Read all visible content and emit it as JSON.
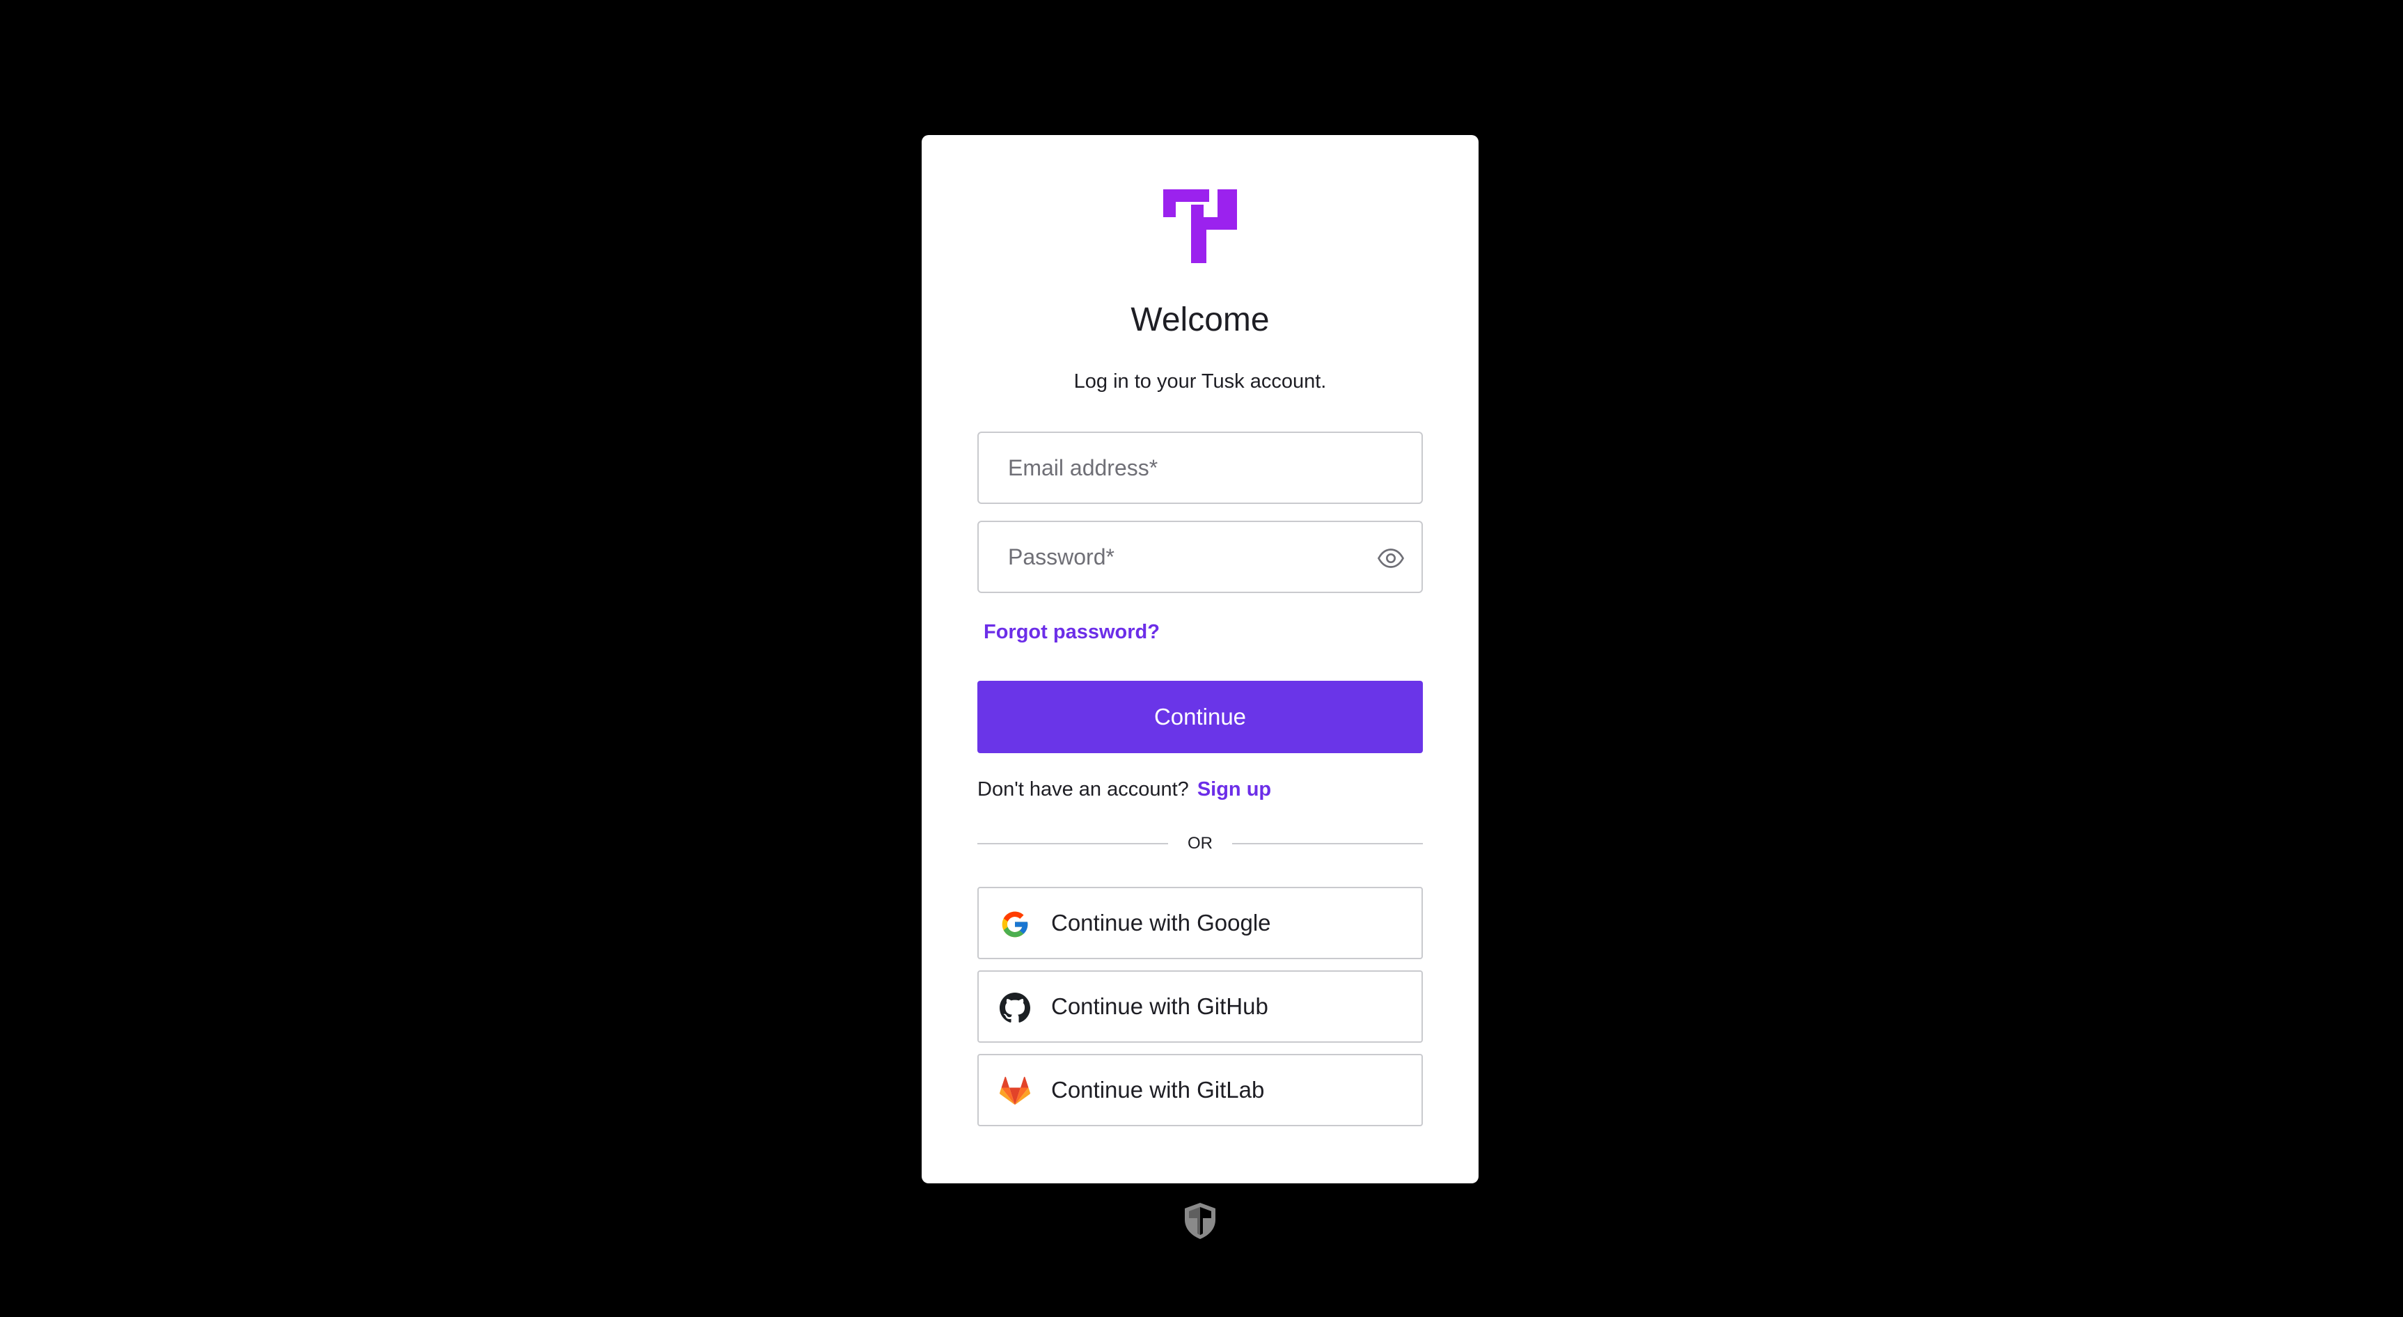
{
  "card": {
    "title": "Welcome",
    "subtitle": "Log in to your Tusk account."
  },
  "form": {
    "email_placeholder": "Email address*",
    "email_value": "",
    "password_placeholder": "Password*",
    "password_value": "",
    "forgot_password_label": "Forgot password?",
    "continue_label": "Continue"
  },
  "signup": {
    "prompt": "Don't have an account?",
    "link_label": "Sign up"
  },
  "divider": {
    "label": "OR"
  },
  "social": {
    "google_label": "Continue with Google",
    "github_label": "Continue with GitHub",
    "gitlab_label": "Continue with GitLab"
  },
  "icons": {
    "logo": "tusk-logo-icon",
    "password_toggle": "eye-icon",
    "google": "google-icon",
    "github": "github-icon",
    "gitlab": "gitlab-icon",
    "footer": "shield-icon"
  },
  "colors": {
    "page_background": "#000000",
    "card_background": "#ffffff",
    "brand_purple": "#6a35e8",
    "link_purple": "#6c2ee8",
    "logo_purple": "#9b22ee",
    "border_gray": "#c9cace"
  }
}
